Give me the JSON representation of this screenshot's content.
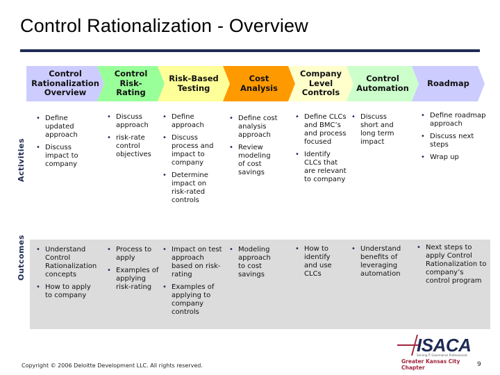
{
  "header": {
    "title": "Control Rationalization - Overview"
  },
  "chevrons": [
    {
      "label": "Control Rationalization Overview",
      "color": "#ccccff"
    },
    {
      "label": "Control Risk-Rating",
      "color": "#99ff99"
    },
    {
      "label": "Risk-Based Testing",
      "color": "#ffff99"
    },
    {
      "label": "Cost Analysis",
      "color": "#ff9900"
    },
    {
      "label": "Company Level Controls",
      "color": "#ffffcc"
    },
    {
      "label": "Control Automation",
      "color": "#ccffcc"
    },
    {
      "label": "Roadmap",
      "color": "#ccccff"
    }
  ],
  "rows": {
    "activities_label": "Activities",
    "outcomes_label": "Outcomes"
  },
  "activities": [
    [
      "Define updated approach",
      "Discuss impact to company"
    ],
    [
      "Discuss approach",
      "risk-rate control objectives"
    ],
    [
      "Define approach",
      "Discuss process and impact to company",
      "Determine impact on risk-rated controls"
    ],
    [
      "Define cost analysis approach",
      "Review modeling of cost savings"
    ],
    [
      "Define CLCs and BMC’s and process focused",
      "Identify CLCs that are relevant to company"
    ],
    [
      "Discuss short and long term impact"
    ],
    [
      "Define roadmap approach",
      "Discuss next steps",
      "Wrap up"
    ]
  ],
  "outcomes": [
    [
      "Understand Control Rationalization concepts",
      "How to apply to company"
    ],
    [
      "Process to apply",
      "Examples of applying risk-rating"
    ],
    [
      "Impact on test approach based on risk-rating",
      "Examples of applying to company controls"
    ],
    [
      "Modeling approach to cost savings"
    ],
    [
      "How to identify and use CLCs"
    ],
    [
      "Understand benefits of leveraging automation"
    ],
    [
      "Next steps to apply Control Rationalization to company’s control program"
    ]
  ],
  "footer": {
    "copyright": "Copyright © 2006 Deloitte Development LLC. All rights reserved.",
    "page_number": "9",
    "logo_text": "ISACA",
    "logo_tagline": "Serving IT Governance Professionals",
    "logo_chapter": "Greater Kansas City Chapter"
  }
}
